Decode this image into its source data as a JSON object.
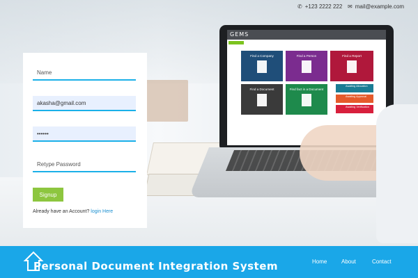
{
  "topbar": {
    "phone_icon": "phone-icon",
    "phone": "+123 2222 222",
    "mail_icon": "mail-icon",
    "email": "mail@example.com"
  },
  "form": {
    "name_placeholder": "Name",
    "email_value": "akasha@gmail.com",
    "password_value": "••••••",
    "retype_placeholder": "Retype Password",
    "signup_label": "Signup",
    "already_text": "Already have an Account?",
    "login_link": "login Here"
  },
  "laptop": {
    "app_title": "GEMS",
    "tiles": [
      {
        "label": "Find a Company",
        "color": "#1f4e79"
      },
      {
        "label": "Find a Person",
        "color": "#7b2c8f"
      },
      {
        "label": "Find a Report",
        "color": "#b0183b"
      },
      {
        "label": "Find a Document",
        "color": "#3a3a3a"
      },
      {
        "label": "Find fact in a Document",
        "color": "#1e8a4c"
      }
    ],
    "mini_items": [
      {
        "label": "Awaiting Allocation",
        "color": "#1a7c94"
      },
      {
        "label": "Awaiting Approval",
        "color": "#e55a2b"
      },
      {
        "label": "Awaiting Verification",
        "color": "#d81f3c"
      }
    ]
  },
  "nav": {
    "brand": "Personal Document Integration System",
    "home_icon": "house-icon",
    "items": [
      "Home",
      "About",
      "Contact"
    ]
  },
  "colors": {
    "accent": "#1aa7e8",
    "signup": "#8dc63f",
    "link": "#1a8fd0"
  }
}
